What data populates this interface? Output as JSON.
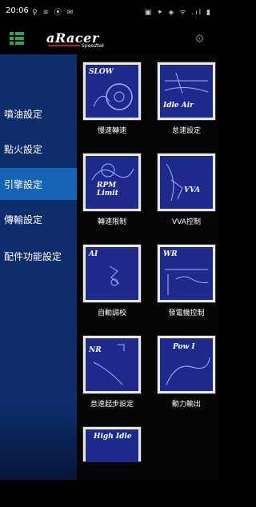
{
  "status": {
    "time": "20:06",
    "left_icons": "♀ ≋ ⦿ ✉",
    "right_icons": "▣ ✦ ◈ ᯤ .ıl ▮"
  },
  "app": {
    "logo": "aRacer",
    "logo_sub": "Speedtek"
  },
  "sidebar": {
    "items": [
      {
        "label": "噴油設定",
        "active": false
      },
      {
        "label": "點火設定",
        "active": false
      },
      {
        "label": "引擎設定",
        "active": true
      },
      {
        "label": "傳輸設定",
        "active": false
      },
      {
        "label": "配件功能設定",
        "active": false
      }
    ]
  },
  "tiles": [
    {
      "title": "SLOW",
      "label": "慢速轉速"
    },
    {
      "title": "Idle Air",
      "label": "怠速設定"
    },
    {
      "title": "RPM Limit",
      "label": "轉速限制"
    },
    {
      "title": "VVA",
      "label": "VVA控制"
    },
    {
      "title": "AI",
      "label": "自動調校"
    },
    {
      "title": "WR",
      "label": "發電機控制"
    },
    {
      "title": "NR",
      "label": "怠速起步設定"
    },
    {
      "title": "Pow I",
      "label": "動力輸出"
    },
    {
      "title": "High Idle",
      "label": ""
    }
  ]
}
